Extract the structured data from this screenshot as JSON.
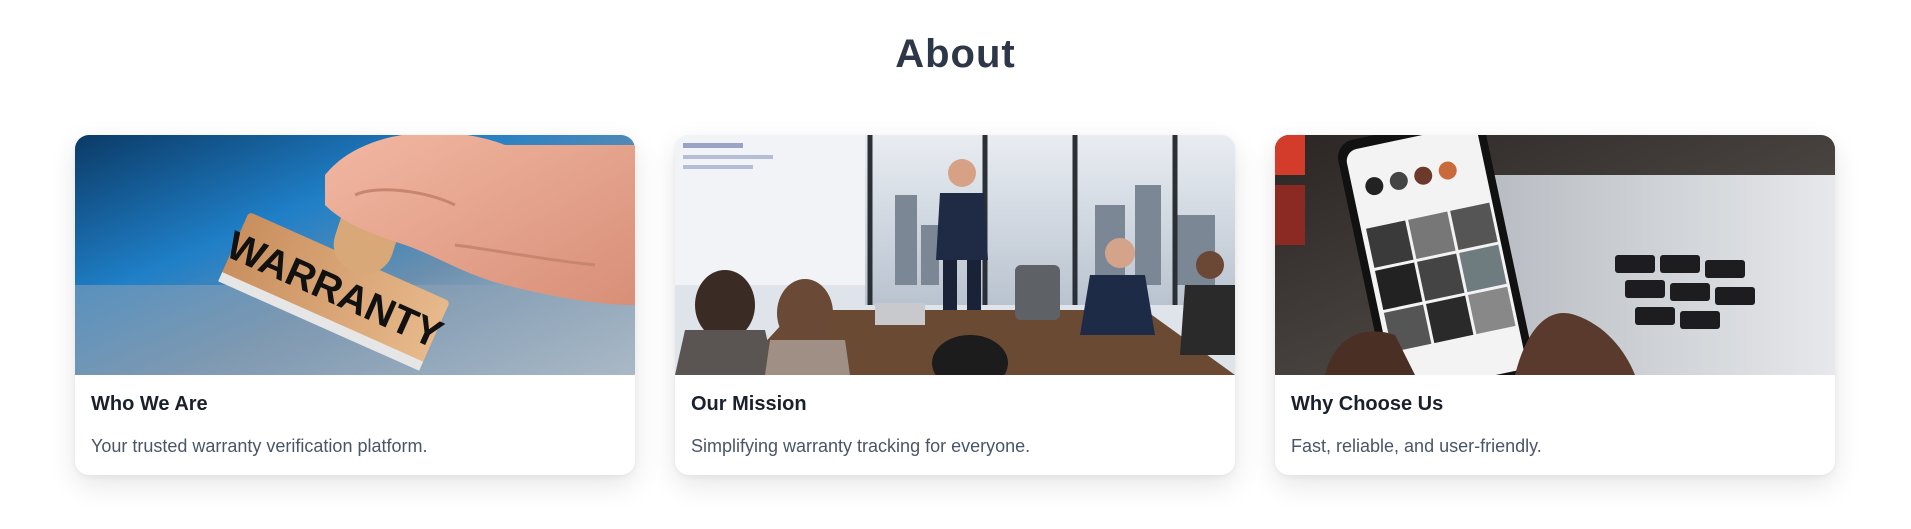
{
  "about": {
    "title": "About",
    "cards": [
      {
        "image_icon": "warranty-stamp-photo",
        "stamp_text": "WARRANTY",
        "title": "Who We Are",
        "text": "Your trusted warranty verification platform."
      },
      {
        "image_icon": "business-meeting-photo",
        "title": "Our Mission",
        "text": "Simplifying warranty tracking for everyone."
      },
      {
        "image_icon": "smartphone-in-hand-photo",
        "title": "Why Choose Us",
        "text": "Fast, reliable, and user-friendly."
      }
    ]
  },
  "colors": {
    "heading": "#2d3748",
    "card_title": "#1a202c",
    "card_text": "#4a5568",
    "background": "#ffffff"
  }
}
